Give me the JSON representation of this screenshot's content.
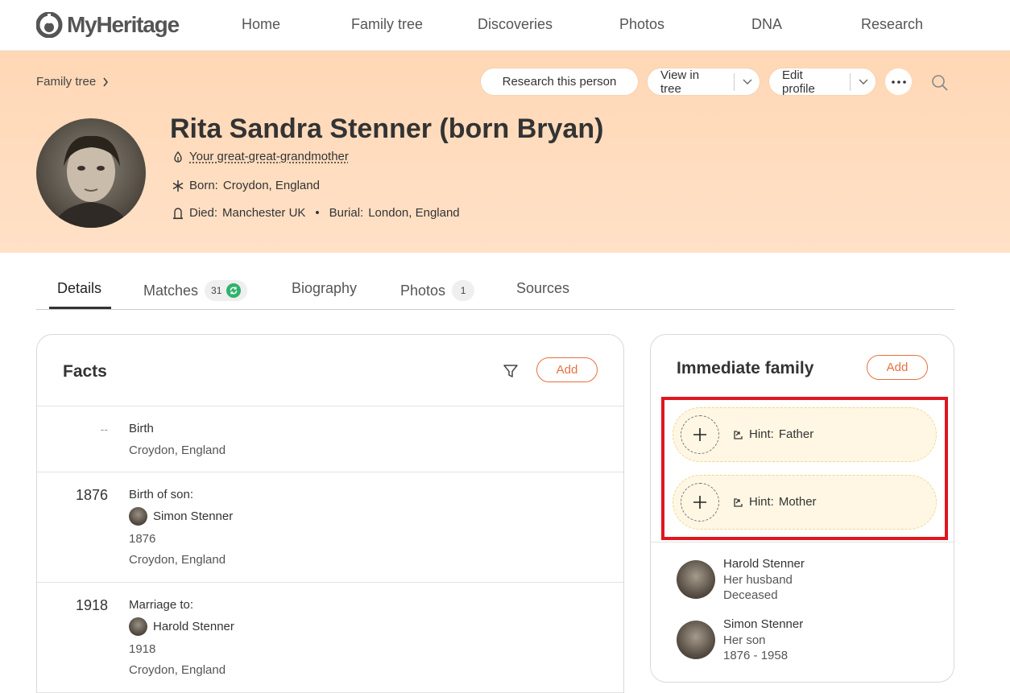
{
  "brand": {
    "name": "MyHeritage",
    "accent": "#e8703e",
    "hero_color": "#ffd7b5",
    "highlight_color": "#e0161f"
  },
  "nav": [
    "Home",
    "Family tree",
    "Discoveries",
    "Photos",
    "DNA",
    "Research"
  ],
  "header": {
    "breadcrumb": "Family tree",
    "actions": {
      "research": "Research this person",
      "view_tree": "View in tree",
      "edit_profile": "Edit profile"
    }
  },
  "person": {
    "name": "Rita Sandra Stenner (born Bryan)",
    "relation": "Your great-great-grandmother",
    "born_label": "Born:",
    "born_place": "Croydon, England",
    "died_label": "Died:",
    "died_place": "Manchester UK",
    "burial_label": "Burial:",
    "burial_place": "London, England"
  },
  "tabs": {
    "details": "Details",
    "matches": "Matches",
    "matches_count": "31",
    "biography": "Biography",
    "photos": "Photos",
    "photos_count": "1",
    "sources": "Sources"
  },
  "facts": {
    "title": "Facts",
    "add_label": "Add",
    "items": [
      {
        "year": "--",
        "title": "Birth",
        "place": "Croydon, England"
      },
      {
        "year": "1876",
        "title": "Birth of son:",
        "person": "Simon Stenner",
        "date": "1876",
        "place": "Croydon, England"
      },
      {
        "year": "1918",
        "title": "Marriage to:",
        "person": "Harold Stenner",
        "date": "1918",
        "place": "Croydon, England"
      }
    ]
  },
  "family": {
    "title": "Immediate family",
    "add_label": "Add",
    "hint_prefix": "Hint:",
    "hints": [
      "Father",
      "Mother"
    ],
    "members": [
      {
        "name": "Harold Stenner",
        "relation": "Her husband",
        "status": "Deceased"
      },
      {
        "name": "Simon Stenner",
        "relation": "Her son",
        "status": "1876 - 1958"
      }
    ]
  }
}
